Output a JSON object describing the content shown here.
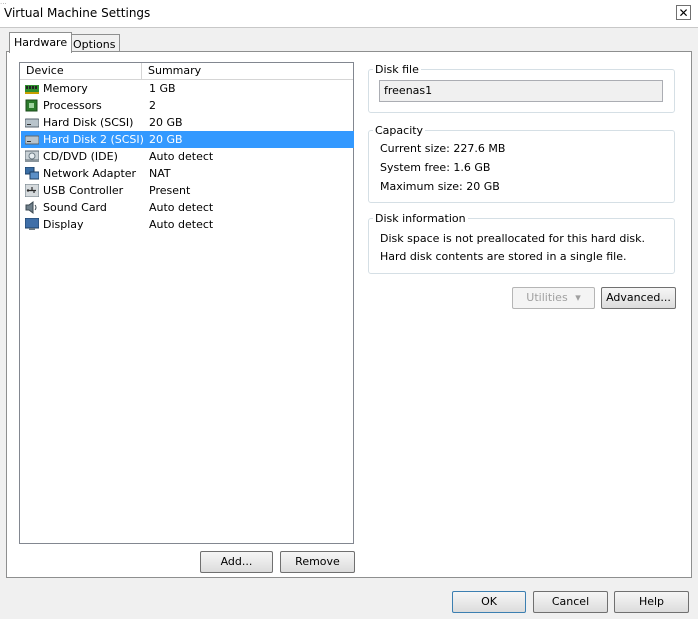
{
  "window": {
    "title": "Virtual Machine Settings",
    "close_glyph": "✕",
    "corner_mark": "..."
  },
  "tabs": [
    {
      "label": "Hardware",
      "active": true
    },
    {
      "label": "Options",
      "active": false
    }
  ],
  "device_list": {
    "columns": [
      "Device",
      "Summary"
    ],
    "rows": [
      {
        "device": "Memory",
        "summary": "1 GB",
        "icon": "memory-icon",
        "selected": false
      },
      {
        "device": "Processors",
        "summary": "2",
        "icon": "processor-icon",
        "selected": false
      },
      {
        "device": "Hard Disk (SCSI)",
        "summary": "20 GB",
        "icon": "hard-disk-icon",
        "selected": false
      },
      {
        "device": "Hard Disk 2 (SCSI)",
        "summary": "20 GB",
        "icon": "hard-disk-icon",
        "selected": true
      },
      {
        "device": "CD/DVD (IDE)",
        "summary": "Auto detect",
        "icon": "cd-dvd-icon",
        "selected": false
      },
      {
        "device": "Network Adapter",
        "summary": "NAT",
        "icon": "network-adapter-icon",
        "selected": false
      },
      {
        "device": "USB Controller",
        "summary": "Present",
        "icon": "usb-icon",
        "selected": false
      },
      {
        "device": "Sound Card",
        "summary": "Auto detect",
        "icon": "sound-card-icon",
        "selected": false
      },
      {
        "device": "Display",
        "summary": "Auto detect",
        "icon": "display-icon",
        "selected": false
      }
    ]
  },
  "list_buttons": {
    "add": "Add...",
    "remove": "Remove"
  },
  "disk_file": {
    "label": "Disk file",
    "value": "freenas1"
  },
  "capacity": {
    "label": "Capacity",
    "current_size": "Current size:  227.6 MB",
    "system_free": "System free:  1.6 GB",
    "maximum_size": "Maximum size:  20 GB"
  },
  "disk_information": {
    "label": "Disk information",
    "line1": "Disk space is not preallocated for this hard disk.",
    "line2": "Hard disk contents are stored in a single file."
  },
  "disk_buttons": {
    "utilities": "Utilities",
    "utilities_arrow": "▾",
    "advanced": "Advanced..."
  },
  "dialog_buttons": {
    "ok": "OK",
    "cancel": "Cancel",
    "help": "Help"
  },
  "colors": {
    "selection": "#3399ff",
    "window_bg": "#f0f0f0"
  }
}
